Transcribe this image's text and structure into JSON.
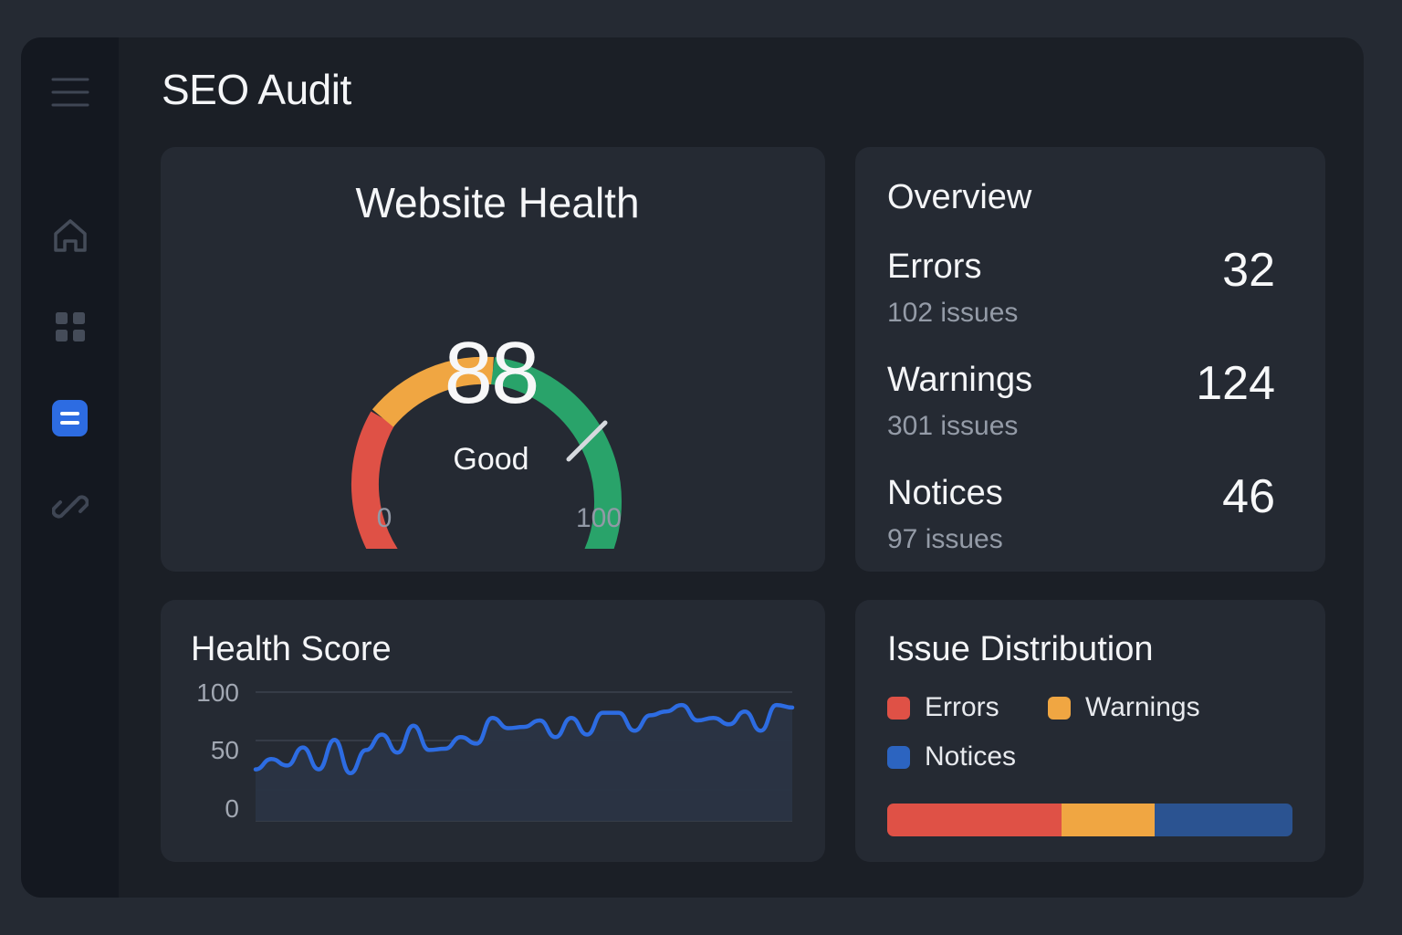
{
  "title": "SEO Audit",
  "sidebar": {
    "items": [
      {
        "icon": "menu-icon"
      },
      {
        "icon": "home-icon"
      },
      {
        "icon": "grid-icon"
      },
      {
        "icon": "audit-icon",
        "active": true
      },
      {
        "icon": "link-icon"
      }
    ],
    "accent": "#2d6ce2"
  },
  "health": {
    "title": "Website Health",
    "score": "88",
    "status": "Good",
    "min": "0",
    "max": "100",
    "gauge_segments": [
      {
        "color": "#df5146"
      },
      {
        "color": "#f0a642"
      },
      {
        "color": "#29a36a"
      }
    ]
  },
  "overview": {
    "title": "Overview",
    "rows": [
      {
        "label": "Errors",
        "sub": "102 issues",
        "value": "32"
      },
      {
        "label": "Warnings",
        "sub": "301 issues",
        "value": "124"
      },
      {
        "label": "Notices",
        "sub": "97 issues",
        "value": "46"
      }
    ]
  },
  "trend": {
    "title": "Health Score",
    "y_ticks": [
      "100",
      "50",
      "0"
    ],
    "line_color": "#2d6ce2"
  },
  "chart_data": {
    "type": "area",
    "title": "Health Score",
    "ylim": [
      0,
      100
    ],
    "y_ticks": [
      100,
      50,
      0
    ],
    "grid": true,
    "x": [
      0,
      1,
      2,
      3,
      4,
      5,
      6,
      7,
      8,
      9,
      10,
      11,
      12,
      13,
      14,
      15,
      16,
      17,
      18,
      19,
      20,
      21,
      22,
      23,
      24,
      25,
      26,
      27,
      28,
      29,
      30,
      31,
      32,
      33,
      34
    ],
    "values": [
      40,
      48,
      43,
      57,
      40,
      63,
      37,
      55,
      67,
      53,
      74,
      55,
      56,
      65,
      60,
      80,
      72,
      73,
      78,
      65,
      80,
      67,
      84,
      84,
      70,
      82,
      85,
      90,
      78,
      80,
      75,
      85,
      70,
      90,
      88
    ]
  },
  "distribution": {
    "title": "Issue Distribution",
    "legend": [
      {
        "label": "Errors",
        "color": "#df5146"
      },
      {
        "label": "Warnings",
        "color": "#f0a642"
      },
      {
        "label": "Notices",
        "color": "#2c64c0"
      }
    ],
    "segments": [
      {
        "name": "Errors",
        "fraction": 0.43,
        "color": "#df5146"
      },
      {
        "name": "Warnings",
        "fraction": 0.23,
        "color": "#f0a642"
      },
      {
        "name": "Notices",
        "fraction": 0.34,
        "color": "#2b5391"
      }
    ]
  }
}
